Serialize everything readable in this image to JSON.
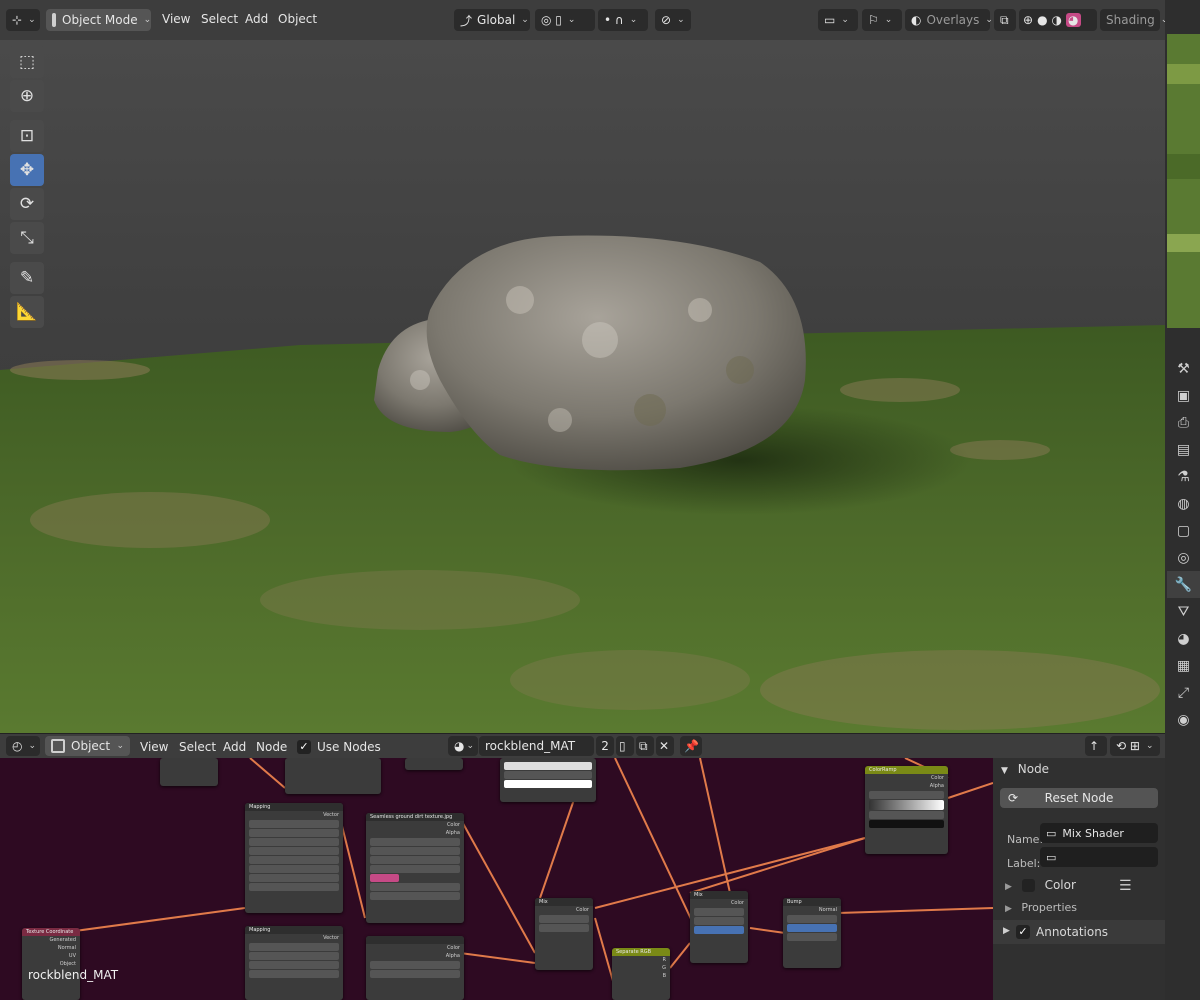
{
  "viewport_header": {
    "mode": "Object Mode",
    "menus": [
      "View",
      "Select",
      "Add",
      "Object"
    ],
    "orientation": "Global",
    "overlays": "Overlays",
    "shading": "Shading"
  },
  "toolbar": {
    "tools": [
      "select-box-icon",
      "cursor-icon",
      "move-icon",
      "move-active-icon",
      "rotate-icon",
      "scale-icon",
      "annotate-icon",
      "measure-icon"
    ]
  },
  "node_editor_header": {
    "object": "Object",
    "menus": [
      "View",
      "Select",
      "Add",
      "Node"
    ],
    "use_nodes": "Use Nodes",
    "material": "rockblend_MAT",
    "users": "2"
  },
  "nodes": [
    {
      "title": "Mapping",
      "kind": "vector"
    },
    {
      "title": "Seamless ground dirt texture.jpg",
      "kind": "texture"
    },
    {
      "title": "Mapping",
      "kind": "vector"
    },
    {
      "title": "Texture Coordinate",
      "kind": "texture"
    },
    {
      "title": "Mix",
      "kind": "color"
    },
    {
      "title": "Separate RGB",
      "kind": "converter"
    },
    {
      "title": "Mix",
      "kind": "color"
    },
    {
      "title": "Bump",
      "kind": "vector"
    },
    {
      "title": "ColorRamp",
      "kind": "converter"
    }
  ],
  "canvas_label": "rockblend_MAT",
  "node_panel": {
    "section": "Node",
    "reset_button": "Reset Node",
    "name_label": "Name:",
    "name_value": "Mix Shader",
    "label_label": "Label:",
    "label_value": "",
    "color": "Color",
    "properties": "Properties",
    "annotations": "Annotations"
  },
  "colors": {
    "accent": "#4772b3",
    "canvas": "#2e0a22",
    "link": "#e07a4a"
  }
}
